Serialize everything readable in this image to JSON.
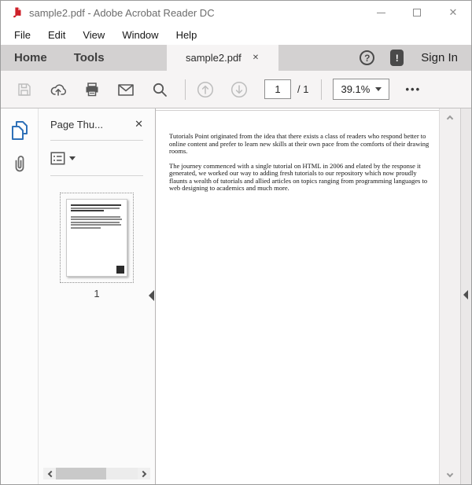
{
  "window": {
    "title": "sample2.pdf - Adobe Acrobat Reader DC"
  },
  "menu_bar": {
    "items": [
      "File",
      "Edit",
      "View",
      "Window",
      "Help"
    ]
  },
  "tab_bar": {
    "home_label": "Home",
    "tools_label": "Tools",
    "active_tab_label": "sample2.pdf",
    "sign_in_label": "Sign In"
  },
  "toolbar": {
    "page_number_value": "1",
    "page_count_label": "/ 1",
    "zoom_value": "39.1%",
    "more_tools_glyph": "•••"
  },
  "sidebar": {
    "panel_title": "Page Thu...",
    "thumbnail_label": "1"
  },
  "document": {
    "paragraphs": [
      "Tutorials Point originated from the idea that there exists a class of readers  who respond better to online content and prefer to learn new skills at their own pace from the comforts of their drawing rooms.",
      "The journey commenced with a single tutorial on HTML in 2006 and elated by the response it generated,  we worked our way to adding fresh tutorials to our repository which now proudly flaunts a wealth of tutorials and allied articles on topics ranging from programming languages to web designing to academics and much more."
    ]
  },
  "icons": {
    "close_glyph": "✕",
    "question_glyph": "?",
    "exclamation_glyph": "!"
  },
  "colors": {
    "acrobat_red": "#ce2029",
    "thumbnails_blue": "#2f71b8",
    "tab_strip_gray": "#d3d1d1",
    "toolbar_bg": "#f6f4f4",
    "icon_gray": "#585858",
    "disabled_gray": "#bdbdbd"
  }
}
